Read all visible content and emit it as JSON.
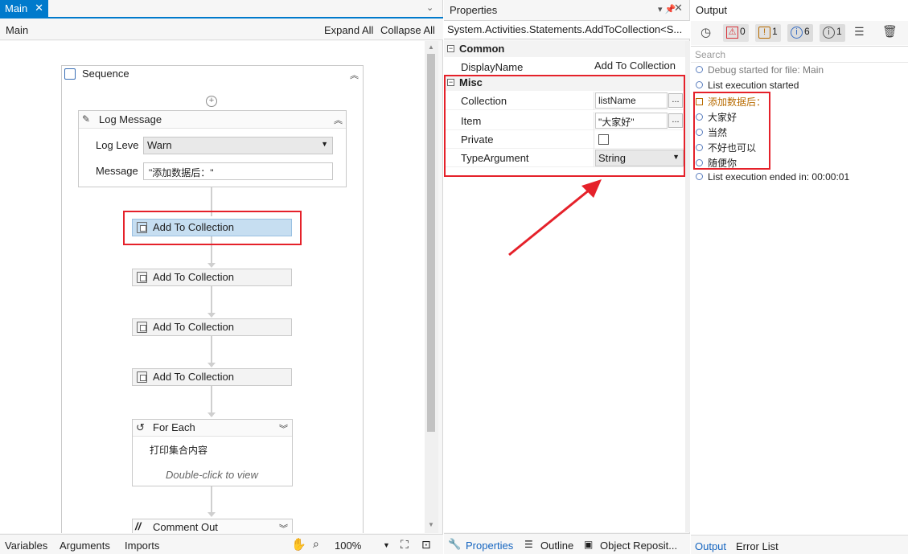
{
  "designer": {
    "tab_label": "Main",
    "breadcrumb": "Main",
    "expand_all": "Expand All",
    "collapse_all": "Collapse All",
    "sequence_title": "Sequence",
    "log_message": {
      "title": "Log Message",
      "level_label": "Log Leve",
      "level_value": "Warn",
      "message_label": "Message",
      "message_value": "\"添加数据后：\""
    },
    "activities": [
      "Add To Collection",
      "Add To Collection",
      "Add To Collection",
      "Add To Collection"
    ],
    "for_each": {
      "title": "For Each",
      "display_name": "打印集合内容",
      "hint": "Double-click to view"
    },
    "comment_out": "Comment Out",
    "footer": {
      "variables": "Variables",
      "arguments": "Arguments",
      "imports": "Imports",
      "zoom": "100%"
    }
  },
  "properties": {
    "panel_title": "Properties",
    "type_name": "System.Activities.Statements.AddToCollection<S...",
    "categories": {
      "common": "Common",
      "misc": "Misc"
    },
    "rows": {
      "display_name_label": "DisplayName",
      "display_name_value": "Add To Collection",
      "collection_label": "Collection",
      "collection_value": "listName",
      "item_label": "Item",
      "item_value": "\"大家好\"",
      "private_label": "Private",
      "private_checked": false,
      "type_argument_label": "TypeArgument",
      "type_argument_value": "String"
    },
    "footer_tabs": [
      "Properties",
      "Outline",
      "Object Reposit..."
    ]
  },
  "output": {
    "panel_title": "Output",
    "counters": {
      "errors": "0",
      "warnings": "1",
      "info": "6",
      "trace": "1"
    },
    "search_placeholder": "Search",
    "lines": [
      "Debug started for file: Main",
      "List execution started",
      "添加数据后：",
      "大家好",
      "当然",
      "不好也可以",
      "随便你",
      "List execution ended in: 00:00:01"
    ],
    "footer_tabs": [
      "Output",
      "Error List"
    ]
  },
  "colors": {
    "accent": "#007acc",
    "highlight_red": "#e5212a",
    "selected_activity": "#c6def1",
    "warning_text": "#b86b00"
  }
}
